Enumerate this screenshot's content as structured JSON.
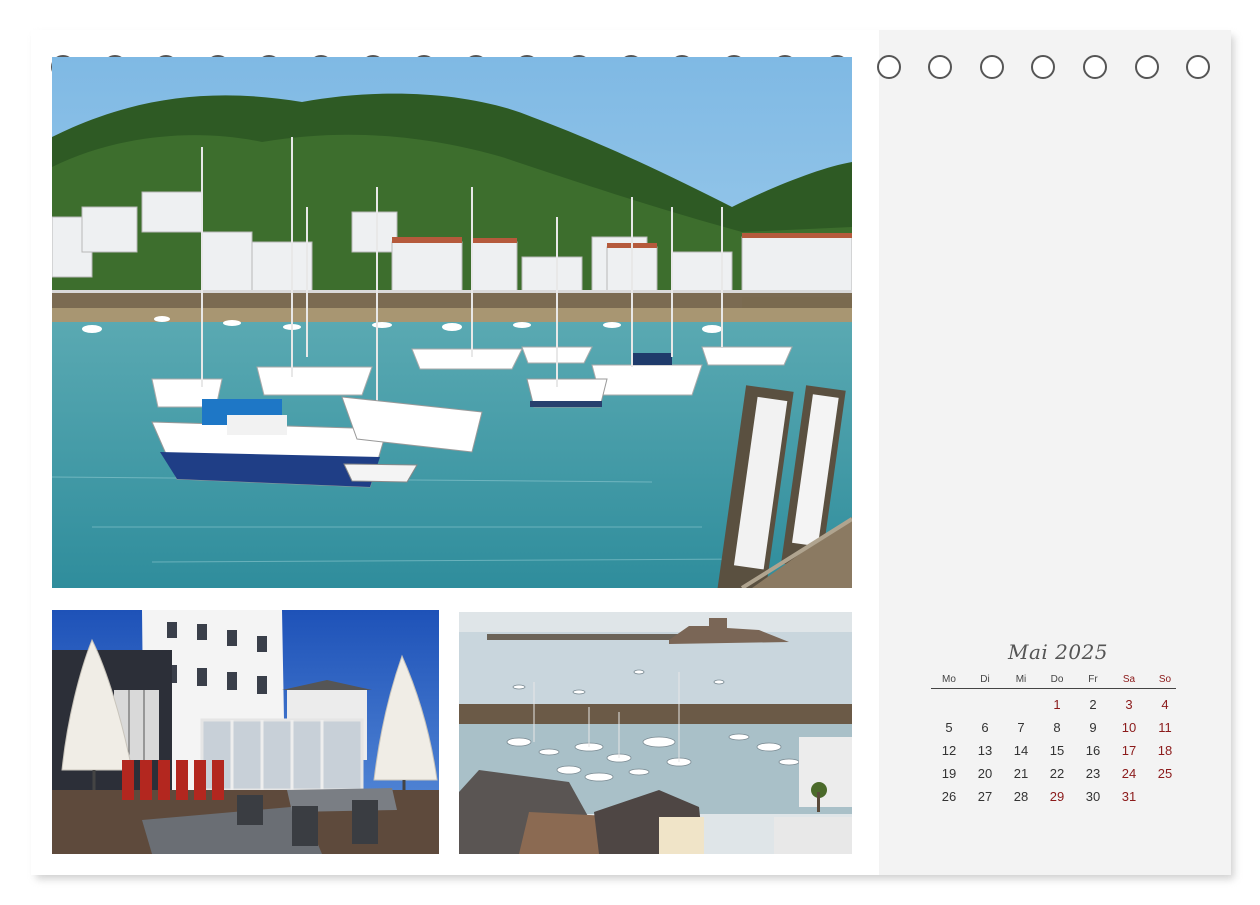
{
  "calendar": {
    "title": "Mai 2025",
    "weekdays": [
      {
        "label": "Mo",
        "weekend": false
      },
      {
        "label": "Di",
        "weekend": false
      },
      {
        "label": "Mi",
        "weekend": false
      },
      {
        "label": "Do",
        "weekend": false
      },
      {
        "label": "Fr",
        "weekend": false
      },
      {
        "label": "Sa",
        "weekend": true
      },
      {
        "label": "So",
        "weekend": true
      }
    ],
    "weeks": [
      [
        {
          "day": "",
          "red": false
        },
        {
          "day": "",
          "red": false
        },
        {
          "day": "",
          "red": false
        },
        {
          "day": "1",
          "red": true
        },
        {
          "day": "2",
          "red": false
        },
        {
          "day": "3",
          "red": true
        },
        {
          "day": "4",
          "red": true
        }
      ],
      [
        {
          "day": "5",
          "red": false
        },
        {
          "day": "6",
          "red": false
        },
        {
          "day": "7",
          "red": false
        },
        {
          "day": "8",
          "red": false
        },
        {
          "day": "9",
          "red": false
        },
        {
          "day": "10",
          "red": true
        },
        {
          "day": "11",
          "red": true
        }
      ],
      [
        {
          "day": "12",
          "red": false
        },
        {
          "day": "13",
          "red": false
        },
        {
          "day": "14",
          "red": false
        },
        {
          "day": "15",
          "red": false
        },
        {
          "day": "16",
          "red": false
        },
        {
          "day": "17",
          "red": true
        },
        {
          "day": "18",
          "red": true
        }
      ],
      [
        {
          "day": "19",
          "red": false
        },
        {
          "day": "20",
          "red": false
        },
        {
          "day": "21",
          "red": false
        },
        {
          "day": "22",
          "red": false
        },
        {
          "day": "23",
          "red": false
        },
        {
          "day": "24",
          "red": true
        },
        {
          "day": "25",
          "red": true
        }
      ],
      [
        {
          "day": "26",
          "red": false
        },
        {
          "day": "27",
          "red": false
        },
        {
          "day": "28",
          "red": false
        },
        {
          "day": "29",
          "red": true
        },
        {
          "day": "30",
          "red": false
        },
        {
          "day": "31",
          "red": true
        },
        {
          "day": "",
          "red": false
        }
      ]
    ]
  },
  "colors": {
    "holiday_red": "#8b1a1a",
    "panel_gray": "#f3f3f3",
    "sea": "#3f9aa8",
    "sky": "#8ec3e8"
  }
}
